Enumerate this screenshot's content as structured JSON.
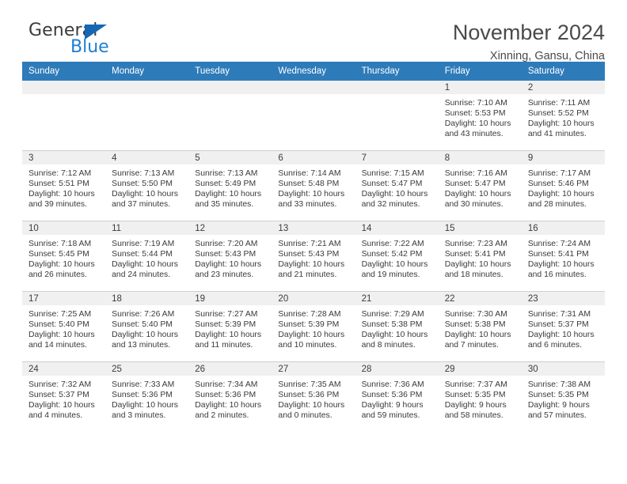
{
  "brand": {
    "name_top": "General",
    "name_bottom": "Blue",
    "triangle_color": "#1567b5",
    "text_color_top": "#3b3b3b",
    "text_color_bottom": "#1d7fd1"
  },
  "header": {
    "title": "November 2024",
    "subtitle": "Xinning, Gansu, China"
  },
  "theme": {
    "header_band": "#2e7bba",
    "daynum_strip": "#f0f0f0",
    "grid_line": "#cfcfcf",
    "text": "#3a3a3a"
  },
  "weekdays": [
    "Sunday",
    "Monday",
    "Tuesday",
    "Wednesday",
    "Thursday",
    "Friday",
    "Saturday"
  ],
  "weeks": [
    [
      {
        "day": "",
        "blank": true
      },
      {
        "day": "",
        "blank": true
      },
      {
        "day": "",
        "blank": true
      },
      {
        "day": "",
        "blank": true
      },
      {
        "day": "",
        "blank": true
      },
      {
        "day": "1",
        "sunrise": "Sunrise: 7:10 AM",
        "sunset": "Sunset: 5:53 PM",
        "daylight": "Daylight: 10 hours and 43 minutes."
      },
      {
        "day": "2",
        "sunrise": "Sunrise: 7:11 AM",
        "sunset": "Sunset: 5:52 PM",
        "daylight": "Daylight: 10 hours and 41 minutes."
      }
    ],
    [
      {
        "day": "3",
        "sunrise": "Sunrise: 7:12 AM",
        "sunset": "Sunset: 5:51 PM",
        "daylight": "Daylight: 10 hours and 39 minutes."
      },
      {
        "day": "4",
        "sunrise": "Sunrise: 7:13 AM",
        "sunset": "Sunset: 5:50 PM",
        "daylight": "Daylight: 10 hours and 37 minutes."
      },
      {
        "day": "5",
        "sunrise": "Sunrise: 7:13 AM",
        "sunset": "Sunset: 5:49 PM",
        "daylight": "Daylight: 10 hours and 35 minutes."
      },
      {
        "day": "6",
        "sunrise": "Sunrise: 7:14 AM",
        "sunset": "Sunset: 5:48 PM",
        "daylight": "Daylight: 10 hours and 33 minutes."
      },
      {
        "day": "7",
        "sunrise": "Sunrise: 7:15 AM",
        "sunset": "Sunset: 5:47 PM",
        "daylight": "Daylight: 10 hours and 32 minutes."
      },
      {
        "day": "8",
        "sunrise": "Sunrise: 7:16 AM",
        "sunset": "Sunset: 5:47 PM",
        "daylight": "Daylight: 10 hours and 30 minutes."
      },
      {
        "day": "9",
        "sunrise": "Sunrise: 7:17 AM",
        "sunset": "Sunset: 5:46 PM",
        "daylight": "Daylight: 10 hours and 28 minutes."
      }
    ],
    [
      {
        "day": "10",
        "sunrise": "Sunrise: 7:18 AM",
        "sunset": "Sunset: 5:45 PM",
        "daylight": "Daylight: 10 hours and 26 minutes."
      },
      {
        "day": "11",
        "sunrise": "Sunrise: 7:19 AM",
        "sunset": "Sunset: 5:44 PM",
        "daylight": "Daylight: 10 hours and 24 minutes."
      },
      {
        "day": "12",
        "sunrise": "Sunrise: 7:20 AM",
        "sunset": "Sunset: 5:43 PM",
        "daylight": "Daylight: 10 hours and 23 minutes."
      },
      {
        "day": "13",
        "sunrise": "Sunrise: 7:21 AM",
        "sunset": "Sunset: 5:43 PM",
        "daylight": "Daylight: 10 hours and 21 minutes."
      },
      {
        "day": "14",
        "sunrise": "Sunrise: 7:22 AM",
        "sunset": "Sunset: 5:42 PM",
        "daylight": "Daylight: 10 hours and 19 minutes."
      },
      {
        "day": "15",
        "sunrise": "Sunrise: 7:23 AM",
        "sunset": "Sunset: 5:41 PM",
        "daylight": "Daylight: 10 hours and 18 minutes."
      },
      {
        "day": "16",
        "sunrise": "Sunrise: 7:24 AM",
        "sunset": "Sunset: 5:41 PM",
        "daylight": "Daylight: 10 hours and 16 minutes."
      }
    ],
    [
      {
        "day": "17",
        "sunrise": "Sunrise: 7:25 AM",
        "sunset": "Sunset: 5:40 PM",
        "daylight": "Daylight: 10 hours and 14 minutes."
      },
      {
        "day": "18",
        "sunrise": "Sunrise: 7:26 AM",
        "sunset": "Sunset: 5:40 PM",
        "daylight": "Daylight: 10 hours and 13 minutes."
      },
      {
        "day": "19",
        "sunrise": "Sunrise: 7:27 AM",
        "sunset": "Sunset: 5:39 PM",
        "daylight": "Daylight: 10 hours and 11 minutes."
      },
      {
        "day": "20",
        "sunrise": "Sunrise: 7:28 AM",
        "sunset": "Sunset: 5:39 PM",
        "daylight": "Daylight: 10 hours and 10 minutes."
      },
      {
        "day": "21",
        "sunrise": "Sunrise: 7:29 AM",
        "sunset": "Sunset: 5:38 PM",
        "daylight": "Daylight: 10 hours and 8 minutes."
      },
      {
        "day": "22",
        "sunrise": "Sunrise: 7:30 AM",
        "sunset": "Sunset: 5:38 PM",
        "daylight": "Daylight: 10 hours and 7 minutes."
      },
      {
        "day": "23",
        "sunrise": "Sunrise: 7:31 AM",
        "sunset": "Sunset: 5:37 PM",
        "daylight": "Daylight: 10 hours and 6 minutes."
      }
    ],
    [
      {
        "day": "24",
        "sunrise": "Sunrise: 7:32 AM",
        "sunset": "Sunset: 5:37 PM",
        "daylight": "Daylight: 10 hours and 4 minutes."
      },
      {
        "day": "25",
        "sunrise": "Sunrise: 7:33 AM",
        "sunset": "Sunset: 5:36 PM",
        "daylight": "Daylight: 10 hours and 3 minutes."
      },
      {
        "day": "26",
        "sunrise": "Sunrise: 7:34 AM",
        "sunset": "Sunset: 5:36 PM",
        "daylight": "Daylight: 10 hours and 2 minutes."
      },
      {
        "day": "27",
        "sunrise": "Sunrise: 7:35 AM",
        "sunset": "Sunset: 5:36 PM",
        "daylight": "Daylight: 10 hours and 0 minutes."
      },
      {
        "day": "28",
        "sunrise": "Sunrise: 7:36 AM",
        "sunset": "Sunset: 5:36 PM",
        "daylight": "Daylight: 9 hours and 59 minutes."
      },
      {
        "day": "29",
        "sunrise": "Sunrise: 7:37 AM",
        "sunset": "Sunset: 5:35 PM",
        "daylight": "Daylight: 9 hours and 58 minutes."
      },
      {
        "day": "30",
        "sunrise": "Sunrise: 7:38 AM",
        "sunset": "Sunset: 5:35 PM",
        "daylight": "Daylight: 9 hours and 57 minutes."
      }
    ]
  ]
}
